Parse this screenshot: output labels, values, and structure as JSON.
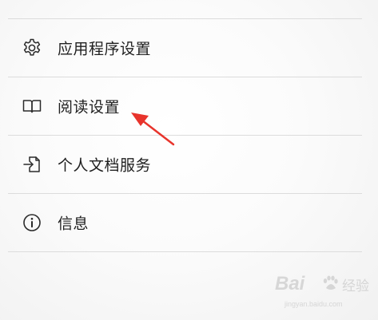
{
  "menu": {
    "items": [
      {
        "icon": "gear-icon",
        "label": "应用程序设置"
      },
      {
        "icon": "book-icon",
        "label": "阅读设置"
      },
      {
        "icon": "document-transfer-icon",
        "label": "个人文档服务"
      },
      {
        "icon": "info-icon",
        "label": "信息"
      }
    ]
  },
  "annotation": {
    "arrow_color": "#e8342c"
  },
  "watermark": {
    "brand": "Bai",
    "jingyan": "经验",
    "url": "jingyan.baidu.com"
  }
}
